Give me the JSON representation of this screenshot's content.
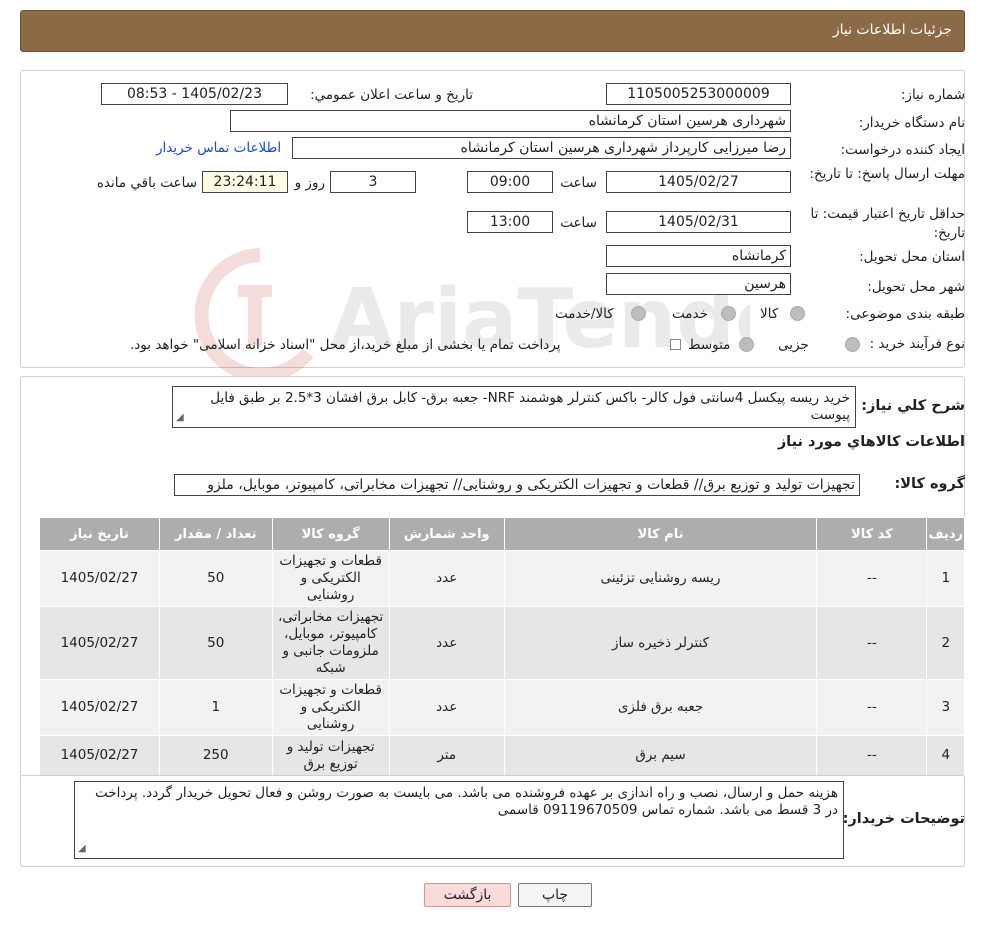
{
  "header": {
    "title": "جزئیات اطلاعات نیاز"
  },
  "watermark": {
    "text": "AriaTender.neT"
  },
  "info": {
    "need_number_label": "شماره نیاز:",
    "need_number": "1105005253000009",
    "announce_label": "تاریخ و ساعت اعلان عمومي:",
    "announce_value": "1405/02/23 - 08:53",
    "buyer_org_label": "نام دستگاه خريدار:",
    "buyer_org": "شهرداری هرسین استان کرمانشاه",
    "creator_label": "ايجاد كننده درخواست:",
    "creator": "رضا میرزایی کارپرداز شهرداری هرسین استان کرمانشاه",
    "contact_link": "اطلاعات تماس خریدار",
    "deadline_label": "مهلت ارسال پاسخ: تا تاریخ:",
    "deadline_date": "1405/02/27",
    "time_label": "ساعت",
    "deadline_time": "09:00",
    "days": "3",
    "days_label": "روز و",
    "remaining_time": "23:24:11",
    "remaining_label": "ساعت باقي مانده",
    "validity_label": "حداقل تاریخ اعتبار قیمت: تا تاریخ:",
    "validity_date": "1405/02/31",
    "validity_time": "13:00",
    "province_label": "استان محل تحویل:",
    "province": "کرمانشاه",
    "city_label": "شهر محل تحویل:",
    "city": "هرسین",
    "category_label": "طبقه بندی موضوعی:",
    "category_options": [
      "کالا",
      "خدمت",
      "کالا/خدمت"
    ],
    "process_label": "نوع فرآیند خرید :",
    "process_options": [
      "جزیی",
      "متوسط"
    ],
    "process_note": "پرداخت تمام یا بخشی از مبلغ خرید،از محل \"اسناد خزانه اسلامی\" خواهد بود."
  },
  "summary": {
    "label": "شرح کلي نياز:",
    "text": "خرید ریسه پیکسل 4سانتی فول کالر- باکس کنترلر هوشمند NRF- جعبه برق- کابل برق افشان 3*2.5 بر طبق فایل پیوست"
  },
  "goods": {
    "heading": "اطلاعات کالاهاي مورد نياز",
    "group_label": "گروه کالا:",
    "group_value": "تجهیزات تولید و توزیع برق// قطعات و تجهیزات الکتریکی و روشنایی// تجهیزات مخابراتی، کامپیوتر، موبایل، ملزو",
    "columns": [
      "رديف",
      "کد کالا",
      "نام کالا",
      "واحد شمارش",
      "گروه کالا",
      "تعداد / مقدار",
      "تاریخ نیاز"
    ],
    "rows": [
      {
        "row": "1",
        "code": "--",
        "name": "ریسه روشنایی تزئینی",
        "unit": "عدد",
        "group": "قطعات و تجهیزات الکتریکی و روشنایی",
        "qty": "50",
        "date": "1405/02/27"
      },
      {
        "row": "2",
        "code": "--",
        "name": "کنترلر ذخیره ساز",
        "unit": "عدد",
        "group": "تجهیزات مخابراتی، کامپیوتر، موبایل، ملزومات جانبی و شبکه",
        "qty": "50",
        "date": "1405/02/27"
      },
      {
        "row": "3",
        "code": "--",
        "name": "جعبه برق فلزی",
        "unit": "عدد",
        "group": "قطعات و تجهیزات الکتریکی و روشنایی",
        "qty": "1",
        "date": "1405/02/27"
      },
      {
        "row": "4",
        "code": "--",
        "name": "سیم برق",
        "unit": "متر",
        "group": "تجهیزات تولید و توزیع برق",
        "qty": "250",
        "date": "1405/02/27"
      }
    ]
  },
  "buyer_notes": {
    "label": "توضيحات خريدار:",
    "text": "هزینه حمل و ارسال، نصب و راه اندازی بر عهده فروشنده می باشد. می بایست به صورت روشن و فعال تحویل خریدار گردد. پرداخت در 3 قسط می باشد. شماره تماس 09119670509 قاسمی"
  },
  "buttons": {
    "print": "چاپ",
    "back": "بازگشت"
  }
}
